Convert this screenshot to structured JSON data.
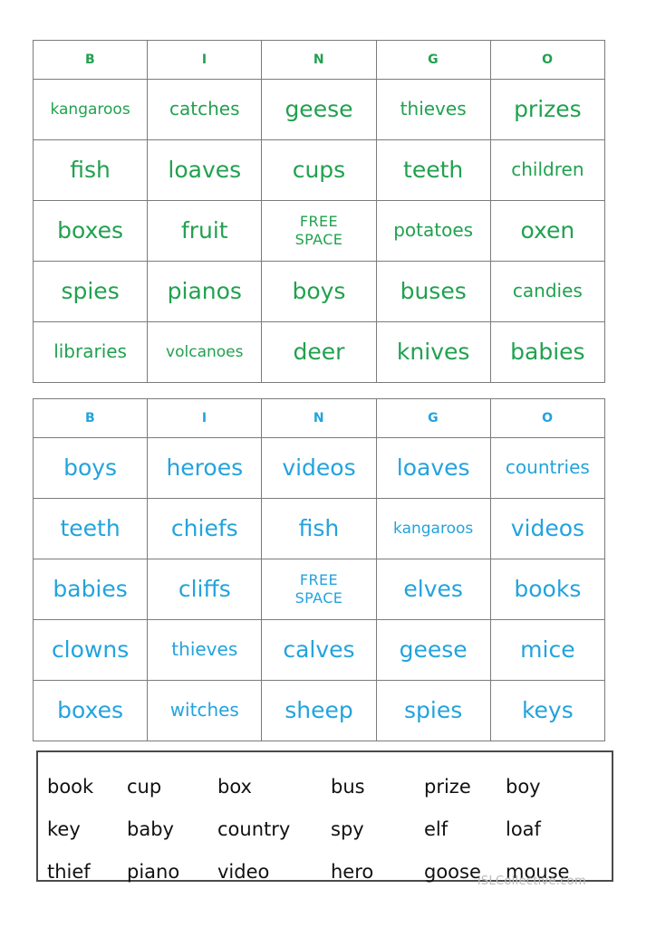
{
  "worksheet": {
    "watermark": "iSLCollective.com"
  },
  "cards": [
    {
      "id": "bingo-card-green",
      "color": "#21a14f",
      "headers": [
        "B",
        "I",
        "N",
        "G",
        "O"
      ],
      "rows": [
        [
          "kangaroos",
          "catches",
          "geese",
          "thieves",
          "prizes"
        ],
        [
          "fish",
          "loaves",
          "cups",
          "teeth",
          "children"
        ],
        [
          "boxes",
          "fruit",
          "FREE SPACE",
          "potatoes",
          "oxen"
        ],
        [
          "spies",
          "pianos",
          "boys",
          "buses",
          "candies"
        ],
        [
          "libraries",
          "volcanoes",
          "deer",
          "knives",
          "babies"
        ]
      ]
    },
    {
      "id": "bingo-card-blue",
      "color": "#23a3dd",
      "headers": [
        "B",
        "I",
        "N",
        "G",
        "O"
      ],
      "rows": [
        [
          "boys",
          "heroes",
          "videos",
          "loaves",
          "countries"
        ],
        [
          "teeth",
          "chiefs",
          "fish",
          "kangaroos",
          "videos"
        ],
        [
          "babies",
          "cliffs",
          "FREE SPACE",
          "elves",
          "books"
        ],
        [
          "clowns",
          "thieves",
          "calves",
          "geese",
          "mice"
        ],
        [
          "boxes",
          "witches",
          "sheep",
          "spies",
          "keys"
        ]
      ]
    }
  ],
  "word_bank": {
    "rows": [
      [
        "book",
        "cup",
        "box",
        "bus",
        "prize",
        "boy"
      ],
      [
        "key",
        "baby",
        "country",
        "spy",
        "elf",
        "loaf"
      ],
      [
        "thief",
        "piano",
        "video",
        "hero",
        "goose",
        "mouse"
      ]
    ]
  }
}
